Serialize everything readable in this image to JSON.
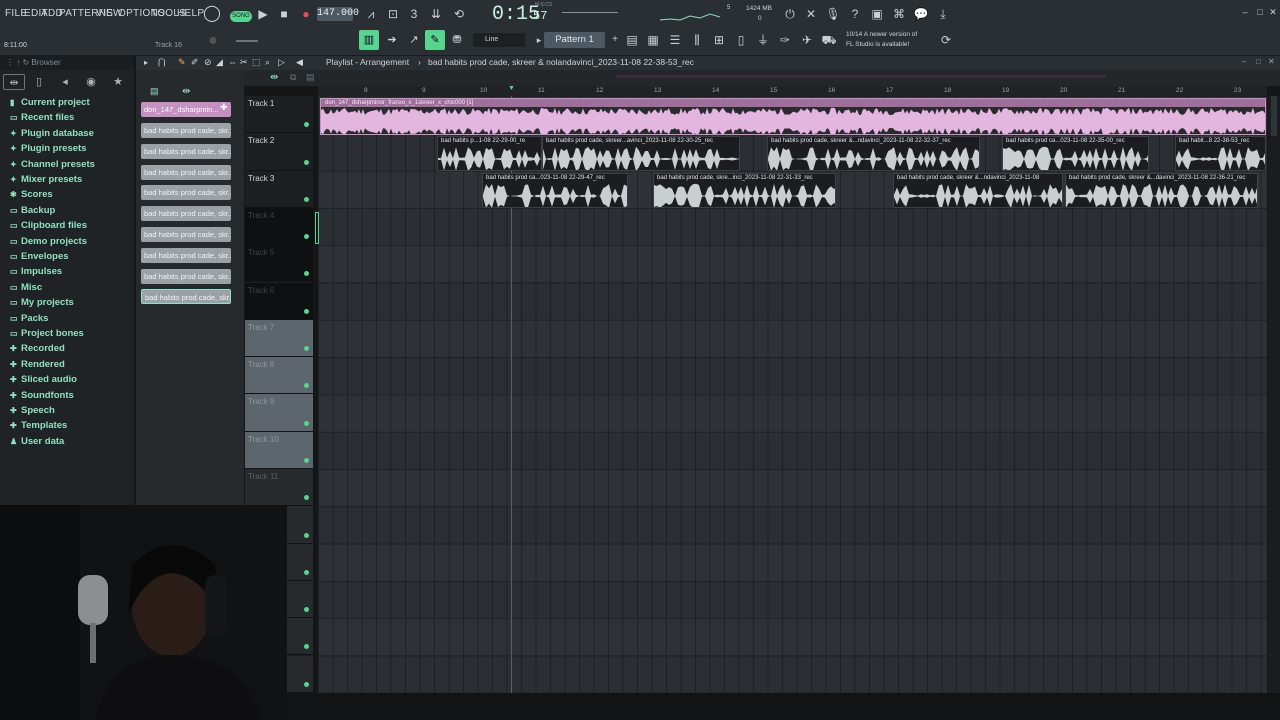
{
  "menu": [
    "FILE",
    "EDIT",
    "ADD",
    "PATTERNS",
    "VIEW",
    "OPTIONS",
    "TOOLS",
    "HELP"
  ],
  "transport": {
    "mode": "SONG",
    "tempo": "147.000",
    "time": "0:15",
    "time_sub": "57",
    "time_label": "M:S:CS",
    "cpu_label": "5",
    "mem": "1424 MB",
    "mem_sub": "0",
    "position": "8:11:00",
    "track_hint": "Track 16"
  },
  "snap": {
    "mode": "Line",
    "pattern": "Pattern 1"
  },
  "news": {
    "counter": "10/14",
    "line1": "A newer version of",
    "line2": "FL Studio is available!"
  },
  "browser": {
    "title": "Browser",
    "items": [
      {
        "label": "Current project",
        "icon": "project-icon"
      },
      {
        "label": "Recent files",
        "icon": "folder-icon"
      },
      {
        "label": "Plugin database",
        "icon": "plugin-icon"
      },
      {
        "label": "Plugin presets",
        "icon": "plugin-icon"
      },
      {
        "label": "Channel presets",
        "icon": "plugin-icon"
      },
      {
        "label": "Mixer presets",
        "icon": "plugin-icon"
      },
      {
        "label": "Scores",
        "icon": "score-icon"
      },
      {
        "label": "Backup",
        "icon": "folder-icon"
      },
      {
        "label": "Clipboard files",
        "icon": "folder-icon"
      },
      {
        "label": "Demo projects",
        "icon": "folder-icon"
      },
      {
        "label": "Envelopes",
        "icon": "folder-icon"
      },
      {
        "label": "Impulses",
        "icon": "folder-icon"
      },
      {
        "label": "Misc",
        "icon": "folder-icon"
      },
      {
        "label": "My projects",
        "icon": "folder-icon"
      },
      {
        "label": "Packs",
        "icon": "folder-icon"
      },
      {
        "label": "Project bones",
        "icon": "folder-icon"
      },
      {
        "label": "Recorded",
        "icon": "plus-icon"
      },
      {
        "label": "Rendered",
        "icon": "plus-icon"
      },
      {
        "label": "Sliced audio",
        "icon": "plus-icon"
      },
      {
        "label": "Soundfonts",
        "icon": "plus-icon"
      },
      {
        "label": "Speech",
        "icon": "plus-icon"
      },
      {
        "label": "Templates",
        "icon": "plus-icon"
      },
      {
        "label": "User data",
        "icon": "user-icon"
      }
    ]
  },
  "picker": {
    "first": "don_147_dsharpmin...",
    "clips": [
      "bad habits prod cade, skr...",
      "bad habits prod cade, skr...",
      "bad habits prod cade, skr...",
      "bad habits prod cade, skr...",
      "bad habits prod cade, skr...",
      "bad habits prod cade, skr...",
      "bad habits prod cade, skr...",
      "bad habits prod cade, skr...",
      "bad habits prod cade, skr..."
    ]
  },
  "playlist": {
    "title": "Playlist - Arrangement",
    "project": "bad habits prod cade, skreer & nolandavinci_2023-11-08 22-38-53_rec",
    "ruler": [
      "8",
      "9",
      "10",
      "11",
      "12",
      "13",
      "14",
      "15",
      "16",
      "17",
      "18",
      "19",
      "20",
      "21",
      "22",
      "23"
    ],
    "tracks": [
      "Track 1",
      "Track 2",
      "Track 3",
      "Track 4",
      "Track 5",
      "Track 6",
      "Track 7",
      "Track 8",
      "Track 9",
      "Track 10",
      "Track 11",
      "",
      "",
      "",
      "",
      ""
    ],
    "track1_clip": "don_147_dsharpminor_franxo_x_1skreer_x_chic000 [1]",
    "track2_clips": [
      "bad habits p...1-08 22-29-00_re",
      "bad habits prod cade, skreer...avinci_2023-11-08 22-30-25_rec",
      "bad habits prod cade, skreer &...ndavinci_2023-11-08 22-32-37_rec",
      "bad habits prod ca...023-11-08 22-35-00_rec",
      "bad habit...8 22-38-53_rec"
    ],
    "track3_clips": [
      "bad habits prod ca...023-11-08 22-29-47_rec",
      "bad habits prod cade, skre...inci_2023-11-08 22-31-33_rec",
      "bad habits prod cade, skreer &...ndavinci_2023-11-08",
      "bad habits prod cade, skreer &...davinci_2023-11-08 22-36-21_rec"
    ]
  },
  "colors": {
    "accent": "#57d48e",
    "pink_clip": "#e2b6de",
    "browser_text": "#8fe0c0"
  }
}
